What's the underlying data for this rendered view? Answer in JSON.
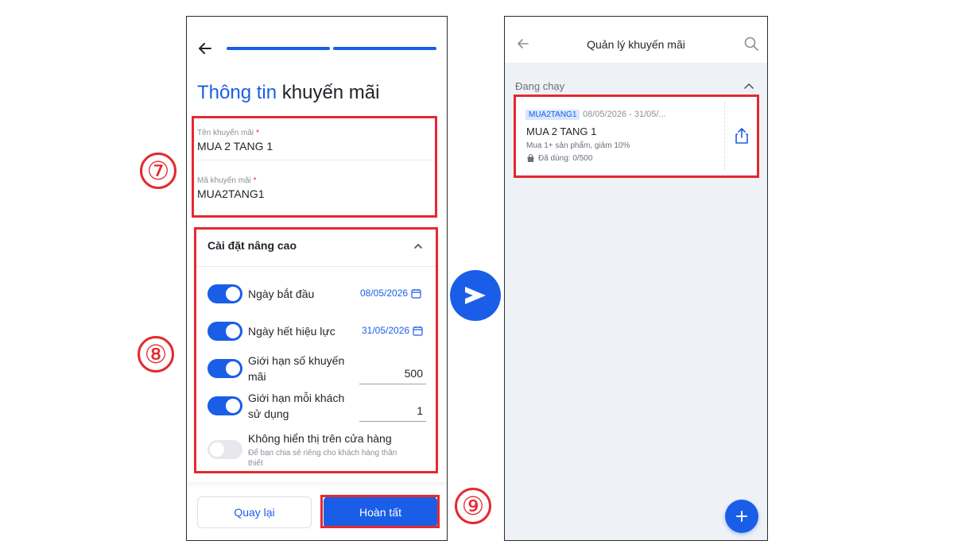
{
  "form": {
    "title_blue": "Thông tin",
    "title_dark": " khuyến mãi",
    "fields": [
      {
        "label": "Tên khuyến mãi",
        "required_mark": "*",
        "value": "MUA 2 TANG 1"
      },
      {
        "label": "Mã khuyến mãi",
        "required_mark": "*",
        "value": "MUA2TANG1"
      }
    ],
    "progress_steps": 2,
    "progress_completed": 2
  },
  "advanced": {
    "title": "Cài đặt nâng cao",
    "settings": [
      {
        "label": "Ngày bắt đầu",
        "enabled": true,
        "value": "08/05/2026"
      },
      {
        "label": "Ngày hết hiệu lực",
        "enabled": true,
        "value": "31/05/2026"
      },
      {
        "label_line1": "Giới hạn số khuyến",
        "label_line2": "mãi",
        "enabled": true,
        "value": "500"
      },
      {
        "label_line1": "Giới hạn mỗi khách",
        "label_line2": "sử dụng",
        "enabled": true,
        "value": "1"
      },
      {
        "label": "Không hiển thị trên cửa hàng",
        "sub_line1": "Để bạn chia sẻ riêng cho khách hàng thân",
        "sub_line2": "thiết",
        "enabled": false
      }
    ]
  },
  "footer": {
    "back_label": "Quay lại",
    "done_label": "Hoàn tất"
  },
  "steps": {
    "seven": "⑦",
    "eight": "⑧",
    "nine": "⑨"
  },
  "manage": {
    "title": "Quản lý khuyến mãi",
    "section_label": "Đang chạy",
    "promo": {
      "code": "MUA2TANG1",
      "dates": "08/05/2026 - 31/05/...",
      "name": "MUA 2 TANG 1",
      "description": "Mua 1+ sản phẩm, giảm 10%",
      "usage": "Đã dùng: 0/500"
    }
  },
  "icons": {
    "back": "arrow-left-icon",
    "collapse": "chevron-up-icon",
    "calendar": "calendar-icon",
    "next": "chevron-right-icon",
    "search": "search-icon",
    "share": "share-icon",
    "bag": "shopping-bag-icon",
    "add": "plus-icon"
  },
  "colors": {
    "primary": "#1a5ee8",
    "highlight": "#e5292f",
    "toggle_off": "#e6e8ec",
    "code_badge_bg": "#d8e6ff"
  }
}
